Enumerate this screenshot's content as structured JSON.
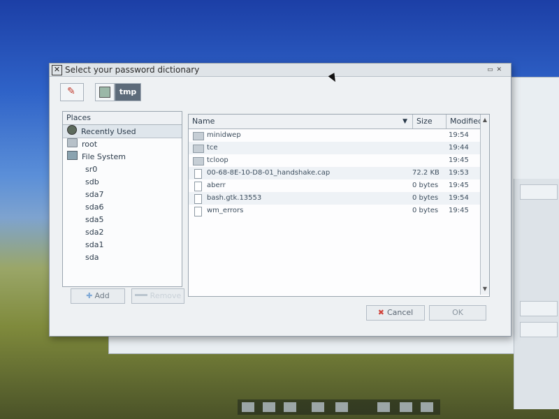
{
  "dialog": {
    "title": "Select your password dictionary",
    "title_controls": "▭ ✕"
  },
  "path_bar": {
    "current": "tmp"
  },
  "places": {
    "header": "Places",
    "items": [
      {
        "label": "Recently Used",
        "icon": "recent-icon"
      },
      {
        "label": "root",
        "icon": "folder-icon"
      },
      {
        "label": "File System",
        "icon": "drive-icon"
      }
    ],
    "devices": [
      "sr0",
      "sdb",
      "sda7",
      "sda6",
      "sda5",
      "sda2",
      "sda1",
      "sda"
    ],
    "add_label": "Add",
    "remove_label": "Remove"
  },
  "files": {
    "columns": {
      "name": "Name",
      "size": "Size",
      "modified": "Modified"
    },
    "rows": [
      {
        "name": "minidwep",
        "size": "",
        "modified": "19:54",
        "type": "folder"
      },
      {
        "name": "tce",
        "size": "",
        "modified": "19:44",
        "type": "folder"
      },
      {
        "name": "tcloop",
        "size": "",
        "modified": "19:45",
        "type": "folder"
      },
      {
        "name": "00-68-8E-10-D8-01_handshake.cap",
        "size": "72.2 KB",
        "modified": "19:53",
        "type": "file"
      },
      {
        "name": "aberr",
        "size": "0 bytes",
        "modified": "19:45",
        "type": "file"
      },
      {
        "name": "bash.gtk.13553",
        "size": "0 bytes",
        "modified": "19:54",
        "type": "file"
      },
      {
        "name": "wm_errors",
        "size": "0 bytes",
        "modified": "19:45",
        "type": "file"
      }
    ]
  },
  "actions": {
    "cancel_label": "Cancel",
    "ok_label": "OK"
  }
}
